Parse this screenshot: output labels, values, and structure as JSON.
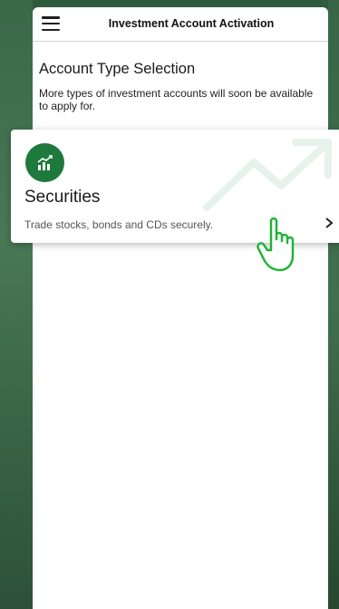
{
  "header": {
    "title": "Investment Account Activation",
    "menu_icon": "hamburger-menu-icon"
  },
  "section": {
    "title": "Account Type Selection",
    "description": "More types of investment accounts will soon be available to apply for."
  },
  "card": {
    "icon": "growth-chart-icon",
    "title": "Securities",
    "description": "Trade stocks, bonds and CDs securely.",
    "chevron_icon": "chevron-right-icon",
    "watermark_icon": "trend-arrow-icon"
  },
  "overlay": {
    "pointer_icon": "hand-pointer-icon"
  },
  "colors": {
    "brand_green": "#1e7a3c",
    "pointer_green": "#22b33a",
    "background_green": "#2f5a3e"
  }
}
